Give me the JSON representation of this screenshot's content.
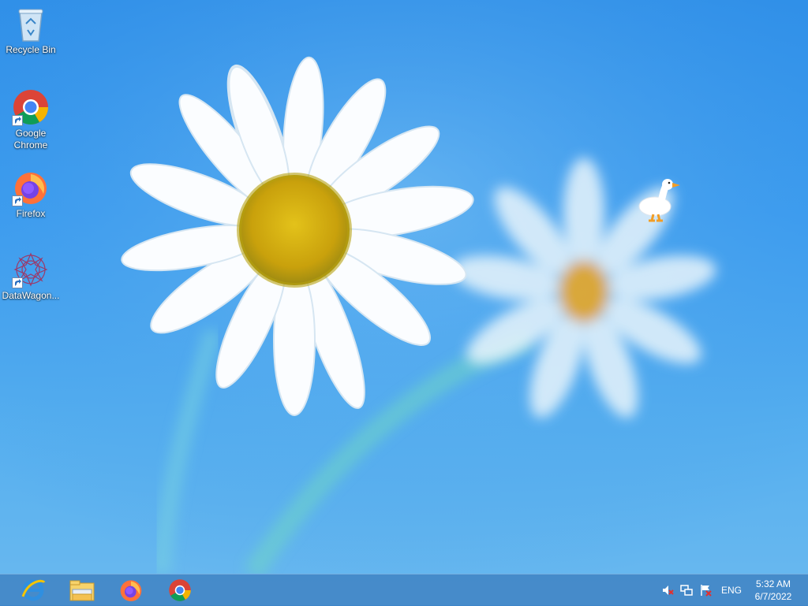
{
  "desktop": {
    "icons": [
      {
        "label": "Recycle Bin",
        "icon": "recycle-bin-icon"
      },
      {
        "label": "Google Chrome",
        "icon": "chrome-icon"
      },
      {
        "label": "Firefox",
        "icon": "firefox-icon"
      },
      {
        "label": "DataWagon...",
        "icon": "datawagon-icon"
      }
    ]
  },
  "taskbar": {
    "pinned": [
      {
        "name": "Internet Explorer",
        "icon": "internet-explorer-icon"
      },
      {
        "name": "File Explorer",
        "icon": "file-explorer-icon"
      },
      {
        "name": "Firefox",
        "icon": "firefox-icon"
      },
      {
        "name": "Google Chrome",
        "icon": "chrome-icon"
      }
    ],
    "tray": {
      "icons": [
        "volume-muted-icon",
        "network-icon",
        "action-center-flag-icon"
      ],
      "language": "ENG",
      "time": "5:32 AM",
      "date": "6/7/2022"
    }
  },
  "colors": {
    "wallpaper_blue": "#3b9bee",
    "taskbar": "#4084c4"
  }
}
